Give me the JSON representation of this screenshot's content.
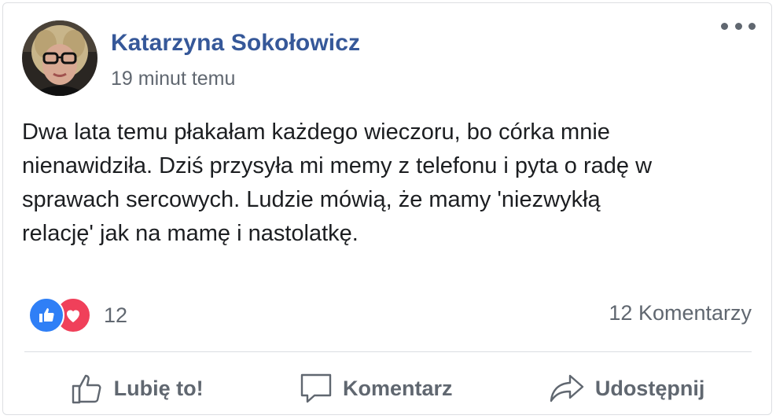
{
  "post": {
    "author": "Katarzyna Sokołowicz",
    "time": "19 minut temu",
    "text": "Dwa lata temu płakałam każdego wieczoru, bo córka mnie\nnienawidziła. Dziś przysyła mi memy z telefonu i pyta o radę w\nsprawach sercowych. Ludzie mówią, że mamy 'niezwykłą\nrelację' jak na mamę i nastolatkę."
  },
  "reactions": {
    "icons": [
      "like-icon",
      "love-icon"
    ],
    "count": "12"
  },
  "comments": {
    "count_label": "12 Komentarzy"
  },
  "actions": {
    "like_label": "Lubię to!",
    "comment_label": "Komentarz",
    "share_label": "Udostępnij"
  },
  "colors": {
    "author": "#365899",
    "secondary_text": "#606770",
    "body_text": "#1c1e21",
    "like_blue": "#2f7ff6",
    "love_red": "#f0405a"
  }
}
